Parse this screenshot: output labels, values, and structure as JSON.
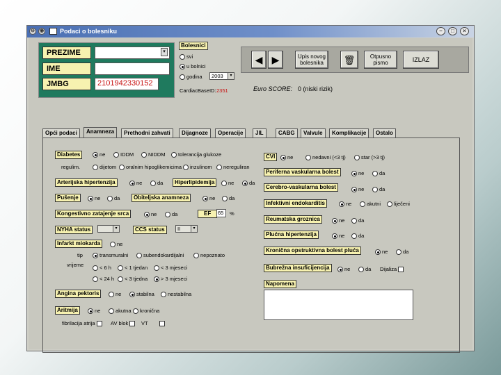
{
  "window": {
    "title": "Podaci o bolesniku"
  },
  "fields": {
    "prezime": {
      "label": "PREZIME",
      "value": ""
    },
    "ime": {
      "label": "IME",
      "value": ""
    },
    "jmbg": {
      "label": "JMBG",
      "value": "2101942330152"
    }
  },
  "bolesnici": {
    "title": "Bolesnici",
    "options": [
      "svi",
      "u bolnici",
      "godina"
    ],
    "selected": "u bolnici",
    "year": "2003",
    "cardiac_base_label": "CardiacBaseID:",
    "cardiac_base_id": "2351"
  },
  "toolbar": {
    "prev_icon": "arrow-left-icon",
    "next_icon": "arrow-right-icon",
    "new_patient": "Upis novog bolesnika",
    "delete_icon": "trash-icon",
    "help": "Otpusno pismo",
    "exit": "IZLAZ"
  },
  "euroscore": {
    "label": "Euro SCORE:",
    "value": "0 (niski rizik)"
  },
  "tabs": [
    "Opći podaci",
    "Anamneza",
    "Prethodni zahvati",
    "Dijagnoze",
    "Operacije",
    "JIL",
    "CABG",
    "Valvule",
    "Komplikacije",
    "Ostalo"
  ],
  "active_tab": "Anamneza",
  "left": {
    "diabetes": {
      "label": "Diabetes",
      "options": [
        "ne",
        "IDDM",
        "NIDDM",
        "tolerancija glukoze"
      ],
      "selected": "ne"
    },
    "diabetes_regulation": {
      "label": "regulirn.",
      "options": [
        "dijetom",
        "oralnim hipoglikemicima",
        "inzulinom",
        "nereguliran"
      ]
    },
    "hipertenzija": {
      "label": "Arterijska hipertenzija",
      "options": [
        "ne",
        "da"
      ],
      "selected": "ne"
    },
    "hiperlipidemija": {
      "label": "Hiperlipidemija",
      "options": [
        "ne",
        "da"
      ],
      "selected": "da"
    },
    "pusenje": {
      "label": "Pušenje",
      "options": [
        "ne",
        "da"
      ],
      "selected": "ne"
    },
    "obiteljska": {
      "label": "Obiteljska anamneza",
      "options": [
        "ne",
        "da"
      ],
      "selected": "ne"
    },
    "kongestivno": {
      "label": "Kongestivno zatajenje srca",
      "options": [
        "ne",
        "da"
      ],
      "selected": "ne"
    },
    "ef": {
      "label": "EF",
      "value": "65",
      "unit": "%"
    },
    "nyha": {
      "label": "NYHA status",
      "value": ""
    },
    "ccs": {
      "label": "CCS status",
      "value": "II"
    },
    "infarkt": {
      "label": "Infarkt miokarda",
      "options": [
        "ne"
      ],
      "selected": ""
    },
    "infarkt_tip": {
      "label": "tip",
      "options": [
        "transmuralni",
        "subendokardijalni",
        "nepoznato"
      ],
      "selected": "transmuralni"
    },
    "infarkt_vrijeme": {
      "label": "vrijeme",
      "options": [
        "< 6 h",
        "< 1 tjedan",
        "< 3 mjeseci",
        "< 24 h",
        "< 3 tjedna",
        "> 3 mjeseci"
      ],
      "selected": "> 3 mjeseci"
    },
    "angina": {
      "label": "Angina pektoris",
      "options": [
        "ne",
        "stabilna",
        "nestabilna"
      ],
      "selected": "stabilna"
    },
    "aritmija": {
      "label": "Aritmija",
      "options": [
        "ne",
        "akutna",
        "kronična"
      ],
      "selected": "ne"
    },
    "aritmija_extra": [
      "fibrilacija atrija",
      "AV blok",
      "VT"
    ]
  },
  "right": {
    "cvi": {
      "label": "CVI",
      "options": [
        "ne",
        "nedavni (<3 tj)",
        "star (>3 tj)"
      ],
      "selected": "ne"
    },
    "periferna": {
      "label": "Periferna vaskularna bolest",
      "options": [
        "ne",
        "da"
      ],
      "selected": "ne"
    },
    "cerebro": {
      "label": "Cerebro-vaskularna bolest",
      "options": [
        "ne",
        "da"
      ],
      "selected": "ne"
    },
    "endokarditis": {
      "label": "Infektivni endokarditis",
      "options": [
        "ne",
        "akutni",
        "liječeni"
      ],
      "selected": "ne"
    },
    "reumatska": {
      "label": "Reumatska groznica",
      "options": [
        "ne",
        "da"
      ],
      "selected": "ne"
    },
    "plucna": {
      "label": "Plućna hipertenzija",
      "options": [
        "ne",
        "da"
      ],
      "selected": "ne"
    },
    "kronicna": {
      "label": "Kronična opstruktivna bolest pluća",
      "options": [
        "ne",
        "da"
      ],
      "selected": "ne"
    },
    "bubrezna": {
      "label": "Bubrežna insuficijencija",
      "options": [
        "ne",
        "da"
      ],
      "selected": "ne",
      "dijaliza": "Dijaliza"
    },
    "napomena": {
      "label": "Napomena",
      "value": ""
    }
  }
}
